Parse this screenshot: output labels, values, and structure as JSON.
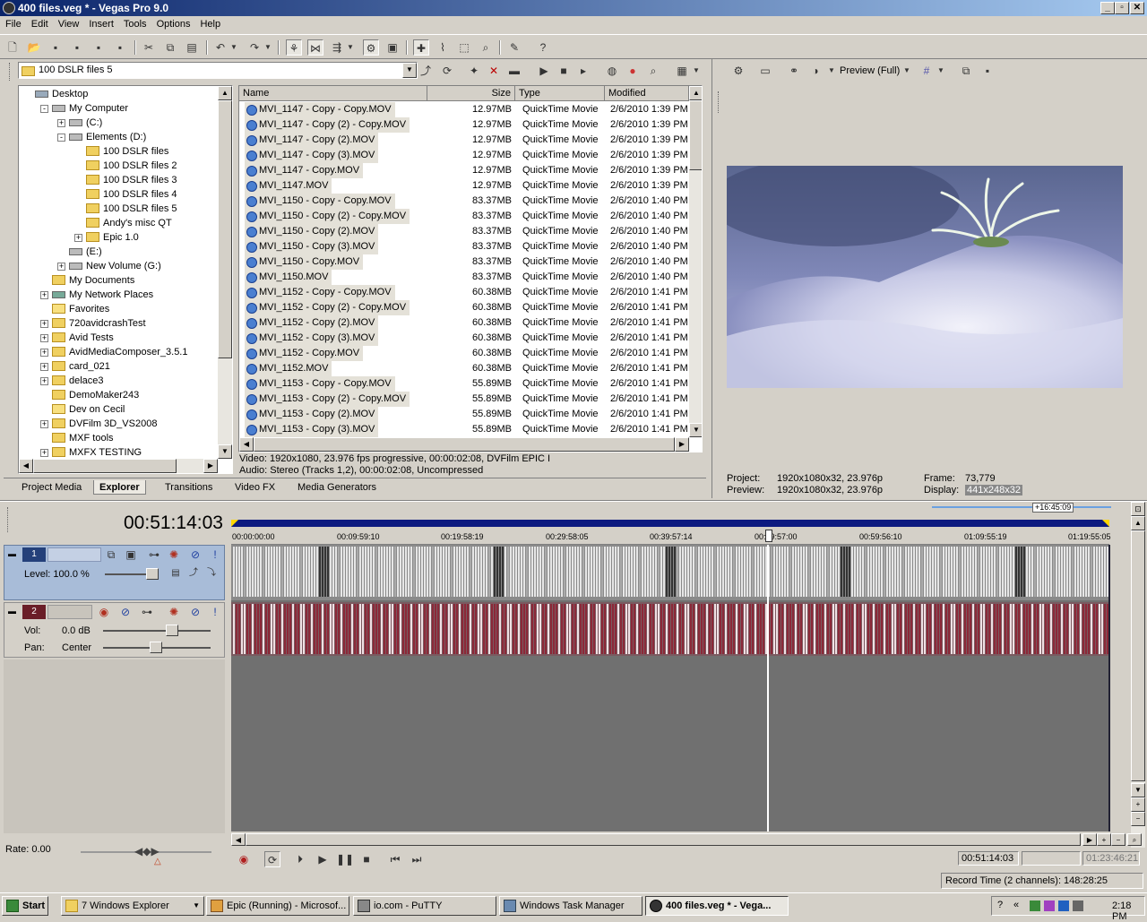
{
  "window": {
    "title": "400 files.veg * - Vegas Pro 9.0"
  },
  "menu": [
    "File",
    "Edit",
    "View",
    "Insert",
    "Tools",
    "Options",
    "Help"
  ],
  "explorer": {
    "path": "100 DSLR files 5",
    "tree": [
      {
        "label": "Desktop",
        "indent": 0,
        "kind": "desktop"
      },
      {
        "label": "My Computer",
        "indent": 1,
        "kind": "computer",
        "exp": "-"
      },
      {
        "label": "(C:)",
        "indent": 2,
        "kind": "drive",
        "exp": "+"
      },
      {
        "label": "Elements (D:)",
        "indent": 2,
        "kind": "drive",
        "exp": "-"
      },
      {
        "label": "100 DSLR files",
        "indent": 3,
        "kind": "folder"
      },
      {
        "label": "100 DSLR files 2",
        "indent": 3,
        "kind": "folder"
      },
      {
        "label": "100 DSLR files 3",
        "indent": 3,
        "kind": "folder"
      },
      {
        "label": "100 DSLR files 4",
        "indent": 3,
        "kind": "folder"
      },
      {
        "label": "100 DSLR files 5",
        "indent": 3,
        "kind": "folder"
      },
      {
        "label": "Andy's misc QT",
        "indent": 3,
        "kind": "folder"
      },
      {
        "label": "Epic 1.0",
        "indent": 3,
        "kind": "folder",
        "exp": "+"
      },
      {
        "label": "(E:)",
        "indent": 2,
        "kind": "drive"
      },
      {
        "label": "New Volume (G:)",
        "indent": 2,
        "kind": "drive",
        "exp": "+"
      },
      {
        "label": "My Documents",
        "indent": 1,
        "kind": "folder"
      },
      {
        "label": "My Network Places",
        "indent": 1,
        "kind": "network",
        "exp": "+"
      },
      {
        "label": "Favorites",
        "indent": 1,
        "kind": "fav"
      },
      {
        "label": "720avidcrashTest",
        "indent": 1,
        "kind": "folder",
        "exp": "+"
      },
      {
        "label": "Avid Tests",
        "indent": 1,
        "kind": "folder",
        "exp": "+"
      },
      {
        "label": "AvidMediaComposer_3.5.1",
        "indent": 1,
        "kind": "folder",
        "exp": "+"
      },
      {
        "label": "card_021",
        "indent": 1,
        "kind": "folder",
        "exp": "+"
      },
      {
        "label": "delace3",
        "indent": 1,
        "kind": "folder",
        "exp": "+"
      },
      {
        "label": "DemoMaker243",
        "indent": 1,
        "kind": "folder"
      },
      {
        "label": "Dev on Cecil",
        "indent": 1,
        "kind": "fav"
      },
      {
        "label": "DVFilm 3D_VS2008",
        "indent": 1,
        "kind": "folder",
        "exp": "+"
      },
      {
        "label": "MXF tools",
        "indent": 1,
        "kind": "folder"
      },
      {
        "label": "MXFX TESTING",
        "indent": 1,
        "kind": "folder",
        "exp": "+"
      }
    ],
    "columns": {
      "name": "Name",
      "size": "Size",
      "type": "Type",
      "modified": "Modified"
    },
    "files": [
      [
        "MVI_1147 - Copy - Copy.MOV",
        "12.97MB",
        "QuickTime Movie",
        "2/6/2010 1:39 PM"
      ],
      [
        "MVI_1147 - Copy (2) - Copy.MOV",
        "12.97MB",
        "QuickTime Movie",
        "2/6/2010 1:39 PM"
      ],
      [
        "MVI_1147 - Copy (2).MOV",
        "12.97MB",
        "QuickTime Movie",
        "2/6/2010 1:39 PM"
      ],
      [
        "MVI_1147 - Copy (3).MOV",
        "12.97MB",
        "QuickTime Movie",
        "2/6/2010 1:39 PM"
      ],
      [
        "MVI_1147 - Copy.MOV",
        "12.97MB",
        "QuickTime Movie",
        "2/6/2010 1:39 PM"
      ],
      [
        "MVI_1147.MOV",
        "12.97MB",
        "QuickTime Movie",
        "2/6/2010 1:39 PM"
      ],
      [
        "MVI_1150 - Copy - Copy.MOV",
        "83.37MB",
        "QuickTime Movie",
        "2/6/2010 1:40 PM"
      ],
      [
        "MVI_1150 - Copy (2) - Copy.MOV",
        "83.37MB",
        "QuickTime Movie",
        "2/6/2010 1:40 PM"
      ],
      [
        "MVI_1150 - Copy (2).MOV",
        "83.37MB",
        "QuickTime Movie",
        "2/6/2010 1:40 PM"
      ],
      [
        "MVI_1150 - Copy (3).MOV",
        "83.37MB",
        "QuickTime Movie",
        "2/6/2010 1:40 PM"
      ],
      [
        "MVI_1150 - Copy.MOV",
        "83.37MB",
        "QuickTime Movie",
        "2/6/2010 1:40 PM"
      ],
      [
        "MVI_1150.MOV",
        "83.37MB",
        "QuickTime Movie",
        "2/6/2010 1:40 PM"
      ],
      [
        "MVI_1152 - Copy - Copy.MOV",
        "60.38MB",
        "QuickTime Movie",
        "2/6/2010 1:41 PM"
      ],
      [
        "MVI_1152 - Copy (2) - Copy.MOV",
        "60.38MB",
        "QuickTime Movie",
        "2/6/2010 1:41 PM"
      ],
      [
        "MVI_1152 - Copy (2).MOV",
        "60.38MB",
        "QuickTime Movie",
        "2/6/2010 1:41 PM"
      ],
      [
        "MVI_1152 - Copy (3).MOV",
        "60.38MB",
        "QuickTime Movie",
        "2/6/2010 1:41 PM"
      ],
      [
        "MVI_1152 - Copy.MOV",
        "60.38MB",
        "QuickTime Movie",
        "2/6/2010 1:41 PM"
      ],
      [
        "MVI_1152.MOV",
        "60.38MB",
        "QuickTime Movie",
        "2/6/2010 1:41 PM"
      ],
      [
        "MVI_1153 - Copy - Copy.MOV",
        "55.89MB",
        "QuickTime Movie",
        "2/6/2010 1:41 PM"
      ],
      [
        "MVI_1153 - Copy (2) - Copy.MOV",
        "55.89MB",
        "QuickTime Movie",
        "2/6/2010 1:41 PM"
      ],
      [
        "MVI_1153 - Copy (2).MOV",
        "55.89MB",
        "QuickTime Movie",
        "2/6/2010 1:41 PM"
      ],
      [
        "MVI_1153 - Copy (3).MOV",
        "55.89MB",
        "QuickTime Movie",
        "2/6/2010 1:41 PM"
      ]
    ],
    "info_video": "Video: 1920x1080, 23.976 fps progressive, 00:00:02:08, DVFilm EPIC I",
    "info_audio": "Audio: Stereo (Tracks 1,2), 00:00:02:08, Uncompressed"
  },
  "tabs": [
    "Project Media",
    "Explorer",
    "Transitions",
    "Video FX",
    "Media Generators"
  ],
  "active_tab": "Explorer",
  "preview": {
    "mode": "Preview (Full)",
    "project_label": "Project:",
    "project_value": "1920x1080x32, 23.976p",
    "preview_label": "Preview:",
    "preview_value": "1920x1080x32, 23.976p",
    "frame_label": "Frame:",
    "frame_value": "73,779",
    "display_label": "Display:",
    "display_value": "441x248x32"
  },
  "timeline": {
    "timecode": "00:51:14:03",
    "ruler": [
      "00:00:00:00",
      "00:09:59:10",
      "00:19:58:19",
      "00:29:58:05",
      "00:39:57:14",
      "00:49:57:00",
      "00:59:56:10",
      "01:09:55:19",
      "01:19:55:05"
    ],
    "marker": "+16:45:09",
    "video_track": {
      "number": "1",
      "level": "Level: 100.0 %"
    },
    "audio_track": {
      "number": "2",
      "vol_label": "Vol:",
      "vol_value": "0.0 dB",
      "pan_label": "Pan:",
      "pan_value": "Center"
    },
    "rate": "Rate: 0.00",
    "tc_left": "00:51:14:03",
    "tc_right": "01:23:46:21",
    "record_time": "Record Time (2 channels): 148:28:25"
  },
  "taskbar": {
    "start": "Start",
    "tasks": [
      "7 Windows Explorer",
      "Epic (Running) - Microsof...",
      "io.com - PuTTY",
      "Windows Task Manager",
      "400 files.veg * - Vega..."
    ],
    "clock": "2:18 PM"
  }
}
